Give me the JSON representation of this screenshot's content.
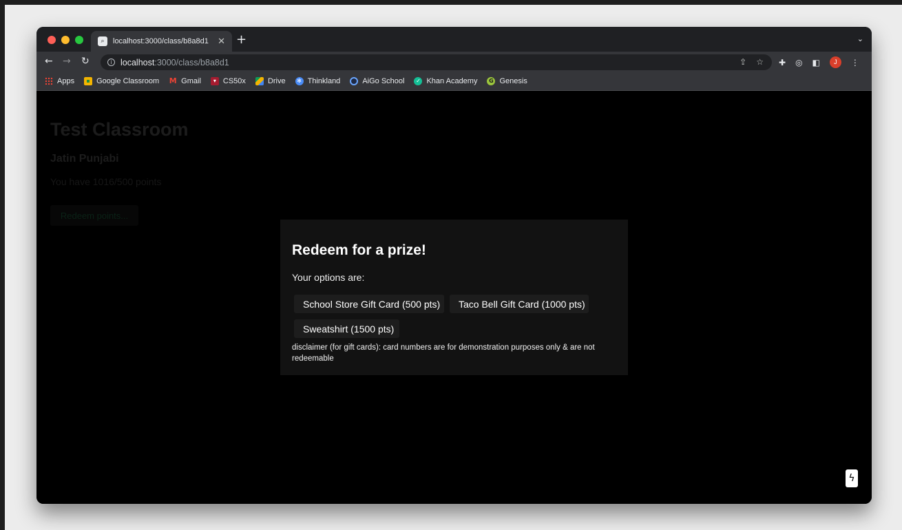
{
  "browser": {
    "tab": {
      "title": "localhost:3000/class/b8a8d1",
      "favicon": "search-icon",
      "close_glyph": "✕"
    },
    "new_tab_glyph": "+",
    "tab_menu_glyph": "⌄",
    "address": {
      "host": "localhost",
      "path": ":3000/class/b8a8d1"
    },
    "profile_initial": "J",
    "bookmarks": [
      {
        "label": "Apps",
        "icon": "apps-grid-icon"
      },
      {
        "label": "Google Classroom",
        "icon": "classroom-icon"
      },
      {
        "label": "Gmail",
        "icon": "gmail-icon"
      },
      {
        "label": "CS50x",
        "icon": "cs50-icon"
      },
      {
        "label": "Drive",
        "icon": "drive-icon"
      },
      {
        "label": "Thinkland",
        "icon": "thinkland-icon"
      },
      {
        "label": "AiGo School",
        "icon": "aigo-icon"
      },
      {
        "label": "Khan Academy",
        "icon": "khan-icon"
      },
      {
        "label": "Genesis",
        "icon": "genesis-icon"
      }
    ]
  },
  "page": {
    "title": "Test Classroom",
    "student_name": "Jatin Punjabi",
    "points_text": "You have 1016/500 points",
    "redeem_button": "Redeem points..."
  },
  "modal": {
    "title": "Redeem for a prize!",
    "subtitle": "Your options are:",
    "options": [
      "School Store Gift Card (500 pts)",
      "Taco Bell Gift Card (1000 pts)",
      "Sweatshirt (1500 pts)"
    ],
    "disclaimer": "disclaimer (for gift cards): card numbers are for demonstration purposes only & are not redeemable"
  },
  "colors": {
    "page_background": "#000000",
    "modal_background": "#121212",
    "option_button": "#1d1d1d",
    "avatar": "#d93f2b"
  }
}
